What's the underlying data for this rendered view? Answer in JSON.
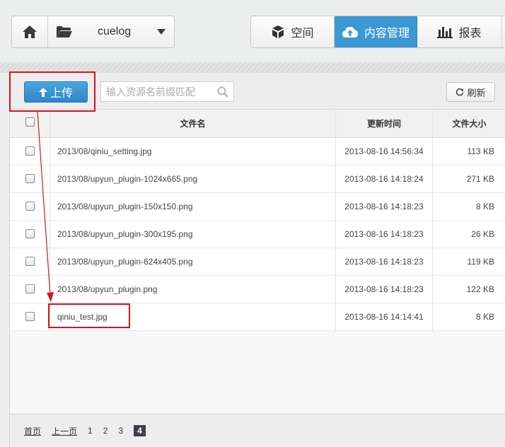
{
  "nav": {
    "bucket_name": "cuelog",
    "tabs": [
      {
        "label": "空间",
        "icon": "box-icon"
      },
      {
        "label": "内容管理",
        "icon": "cloud-upload-icon",
        "active": true
      },
      {
        "label": "报表",
        "icon": "bar-chart-icon"
      }
    ]
  },
  "toolbar": {
    "upload_label": "上传",
    "search_placeholder": "输入资源名前缀匹配",
    "refresh_label": "刷新"
  },
  "table": {
    "headers": {
      "name": "文件名",
      "time": "更新时间",
      "size": "文件大小"
    },
    "rows": [
      {
        "name": "2013/08/qiniu_setting.jpg",
        "time": "2013-08-16 14:56:34",
        "size": "113 KB"
      },
      {
        "name": "2013/08/upyun_plugin-1024x665.png",
        "time": "2013-08-16 14:18:24",
        "size": "271 KB"
      },
      {
        "name": "2013/08/upyun_plugin-150x150.png",
        "time": "2013-08-16 14:18:23",
        "size": "8 KB"
      },
      {
        "name": "2013/08/upyun_plugin-300x195.png",
        "time": "2013-08-16 14:18:23",
        "size": "26 KB"
      },
      {
        "name": "2013/08/upyun_plugin-624x405.png",
        "time": "2013-08-16 14:18:23",
        "size": "119 KB"
      },
      {
        "name": "2013/08/upyun_plugin.png",
        "time": "2013-08-16 14:18:23",
        "size": "122 KB"
      },
      {
        "name": "qiniu_test.jpg",
        "time": "2013-08-16 14:14:41",
        "size": "8 KB"
      }
    ]
  },
  "pagination": {
    "first": "首页",
    "prev": "上一页",
    "pages": [
      "1",
      "2",
      "3"
    ],
    "current": "4"
  },
  "colors": {
    "accent": "#3c98d4",
    "annotation": "#d9141b"
  }
}
